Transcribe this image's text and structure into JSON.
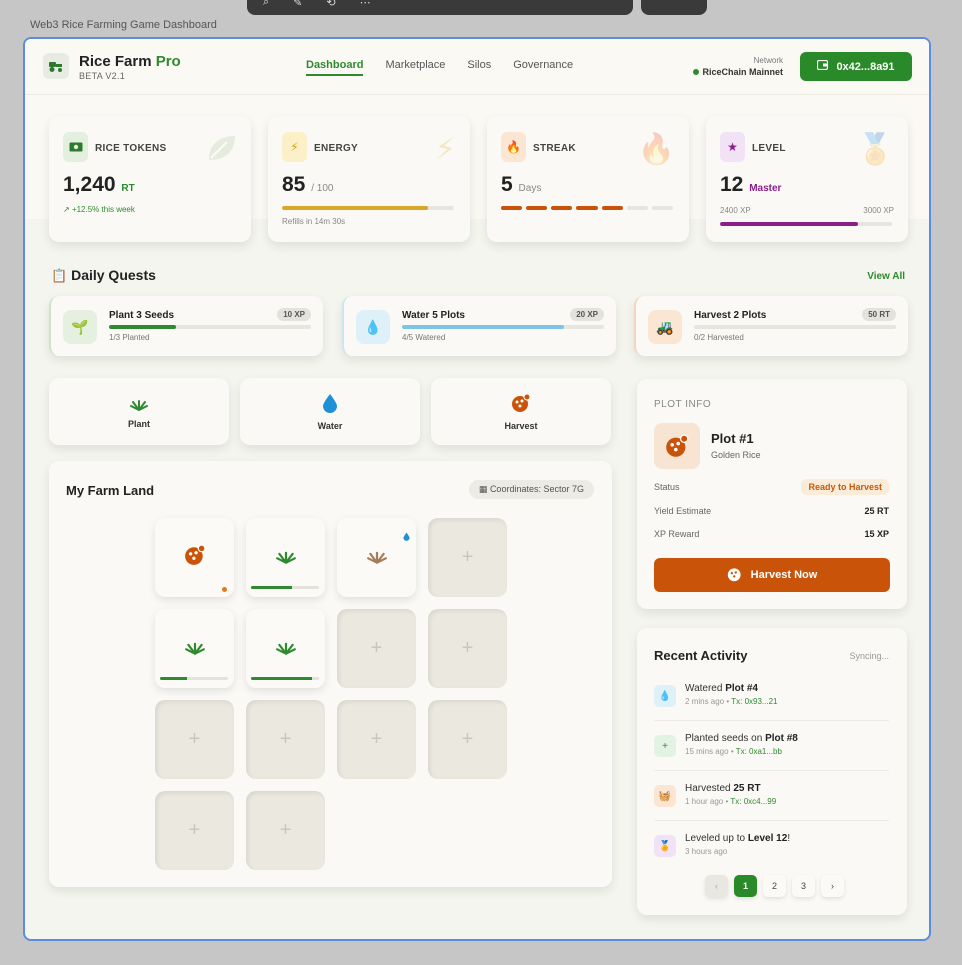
{
  "caption": "Web3 Rice Farming Game Dashboard",
  "header": {
    "brand_main": "Rice Farm",
    "brand_accent": "Pro",
    "beta": "BETA V2.1",
    "nav": [
      {
        "label": "Dashboard",
        "active": true
      },
      {
        "label": "Marketplace",
        "active": false
      },
      {
        "label": "Silos",
        "active": false
      },
      {
        "label": "Governance",
        "active": false
      }
    ],
    "network_label": "Network",
    "network_value": "RiceChain Mainnet",
    "wallet": "0x42...8a91",
    "wallet_icon": "wallet-icon",
    "logo_icon": "tractor-icon"
  },
  "stats": {
    "tokens": {
      "label": "RICE TOKENS",
      "value": "1,240",
      "unit": "RT",
      "sub": "+12.5% this week",
      "icon": "cash-icon",
      "bg_icon": "leaf-icon"
    },
    "energy": {
      "label": "ENERGY",
      "value": "85",
      "unit": "/ 100",
      "sub": "Refills in 14m 30s",
      "progress": 0.85,
      "icon": "bolt-icon",
      "bg_icon": "bolt-icon"
    },
    "streak": {
      "label": "STREAK",
      "value": "5",
      "unit": "Days",
      "segments_total": 7,
      "segments_filled": 5,
      "icon": "flame-icon",
      "bg_icon": "flame-icon"
    },
    "level": {
      "label": "LEVEL",
      "value": "12",
      "unit": "Master",
      "xp_current": "2400 XP",
      "xp_next": "3000 XP",
      "progress": 0.8,
      "icon": "star-icon",
      "bg_icon": "medal-icon"
    }
  },
  "quests": {
    "title": "Daily Quests",
    "view_all": "View All",
    "items": [
      {
        "name": "Plant 3 Seeds",
        "xp": "10 XP",
        "progress_text": "1/3 Planted",
        "progress": 0.333,
        "color": "#2f8a2f",
        "icon_bg": "#e6f0e0",
        "icon": "sprout-icon"
      },
      {
        "name": "Water 5 Plots",
        "xp": "20 XP",
        "progress_text": "4/5 Watered",
        "progress": 0.8,
        "color": "#7cc4e8",
        "icon_bg": "#def0f8",
        "icon": "water-drop-icon"
      },
      {
        "name": "Harvest 2 Plots",
        "xp": "50 RT",
        "progress_text": "0/2 Harvested",
        "progress": 0,
        "color": "#e07a1f",
        "icon_bg": "#fbe6d4",
        "icon": "tractor-icon"
      }
    ]
  },
  "actions": [
    {
      "label": "Plant",
      "icon": "plant-icon"
    },
    {
      "label": "Water",
      "icon": "water-drop-icon"
    },
    {
      "label": "Harvest",
      "icon": "harvest-icon"
    }
  ],
  "farm": {
    "title": "My Farm Land",
    "coords": "Coordinates: Sector 7G",
    "plots": [
      {
        "state": "ready",
        "icon": "harvest-icon",
        "dot": "orange"
      },
      {
        "state": "growing",
        "icon": "plant-icon",
        "progress": 0.6
      },
      {
        "state": "dry",
        "icon": "plant-icon",
        "dot": "water"
      },
      {
        "state": "empty"
      },
      {
        "state": "growing",
        "icon": "plant-icon",
        "progress": 0.4
      },
      {
        "state": "growing",
        "icon": "plant-icon",
        "progress": 0.9
      },
      {
        "state": "empty"
      },
      {
        "state": "empty"
      },
      {
        "state": "empty"
      },
      {
        "state": "empty"
      },
      {
        "state": "empty"
      },
      {
        "state": "empty"
      },
      {
        "state": "empty"
      },
      {
        "state": "empty"
      }
    ]
  },
  "plot_info": {
    "label": "PLOT INFO",
    "title": "Plot #1",
    "subtitle": "Golden Rice",
    "status_label": "Status",
    "status_value": "Ready to Harvest",
    "yield_label": "Yield Estimate",
    "yield_value": "25 RT",
    "xp_label": "XP Reward",
    "xp_value": "15 XP",
    "button": "Harvest Now",
    "icon": "harvest-icon"
  },
  "activity": {
    "title": "Recent Activity",
    "sync": "Syncing...",
    "items": [
      {
        "text_pre": "Watered ",
        "text_bold": "Plot #4",
        "text_post": "",
        "time": "2 mins ago",
        "tx": "Tx: 0x93...21",
        "icon": "water-drop-icon",
        "icon_bg": "#def0f8",
        "icon_color": "#1f8fd6"
      },
      {
        "text_pre": "Planted seeds on ",
        "text_bold": "Plot #8",
        "text_post": "",
        "time": "15 mins ago",
        "tx": "Tx: 0xa1...bb",
        "icon": "plus-icon",
        "icon_bg": "#e3f3e3",
        "icon_color": "#2f8a2f"
      },
      {
        "text_pre": "Harvested ",
        "text_bold": "25 RT",
        "text_post": "",
        "time": "1 hour ago",
        "tx": "Tx: 0xc4...99",
        "icon": "basket-icon",
        "icon_bg": "#fbe6d4",
        "icon_color": "#c95409"
      },
      {
        "text_pre": "Leveled up to ",
        "text_bold": "Level 12",
        "text_post": "!",
        "time": "3 hours ago",
        "tx": "",
        "icon": "medal-icon",
        "icon_bg": "#f1e3f5",
        "icon_color": "#8a1f8a"
      }
    ],
    "pages": [
      "‹",
      "1",
      "2",
      "3",
      "›"
    ],
    "active_page": "1"
  }
}
